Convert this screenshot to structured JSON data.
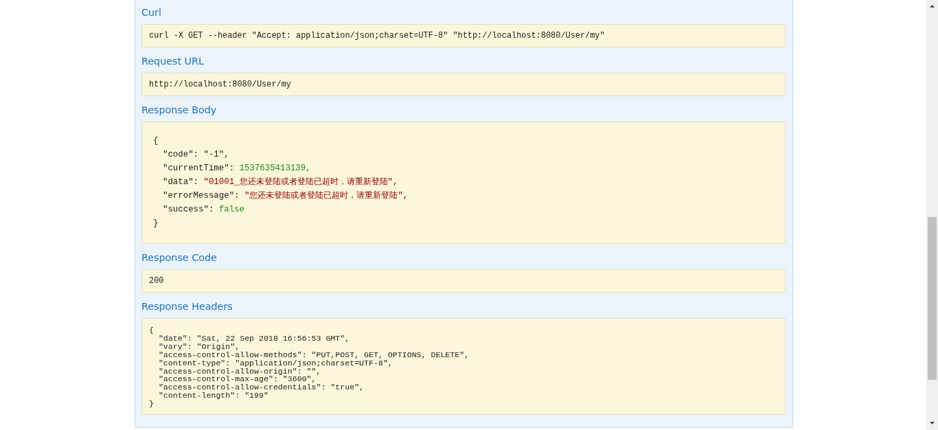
{
  "sections": [
    {
      "heading": "Curl",
      "kind": "plain",
      "text": "curl -X GET --header \"Accept: application/json;charset=UTF-8\" \"http://localhost:8080/User/my\""
    },
    {
      "heading": "Request URL",
      "kind": "plain",
      "text": "http://localhost:8080/User/my"
    },
    {
      "heading": "Response Body",
      "kind": "json",
      "lines": [
        {
          "kind": "brace",
          "text": "{"
        },
        {
          "key": "\"code\": ",
          "value": "\"-1\",",
          "kind": "plain"
        },
        {
          "key": "\"currentTime\": ",
          "value": "1537635413139,",
          "kind": "number"
        },
        {
          "key": "\"data\": ",
          "value": "\"01001_您还未登陆或者登陆已超时，请重新登陆\",",
          "kind": "string"
        },
        {
          "key": "\"errorMessage\": ",
          "value": "\"您还未登陆或者登陆已超时，请重新登陆\",",
          "kind": "string"
        },
        {
          "key": "\"success\": ",
          "value": "false",
          "kind": "boolean"
        },
        {
          "kind": "brace",
          "text": "}"
        }
      ]
    },
    {
      "heading": "Response Code",
      "kind": "plain",
      "text": "200"
    },
    {
      "heading": "Response Headers",
      "kind": "headers",
      "lines": [
        "{",
        "  \"date\": \"Sat, 22 Sep 2018 16:56:53 GMT\",",
        "  \"vary\": \"Origin\",",
        "  \"access-control-allow-methods\": \"PUT,POST, GET, OPTIONS, DELETE\",",
        "  \"content-type\": \"application/json;charset=UTF-8\",",
        "  \"access-control-allow-origin\": \"\",",
        "  \"access-control-max-age\": \"3600\",",
        "  \"access-control-allow-credentials\": \"true\",",
        "  \"content-length\": \"199\"",
        "}"
      ]
    }
  ]
}
